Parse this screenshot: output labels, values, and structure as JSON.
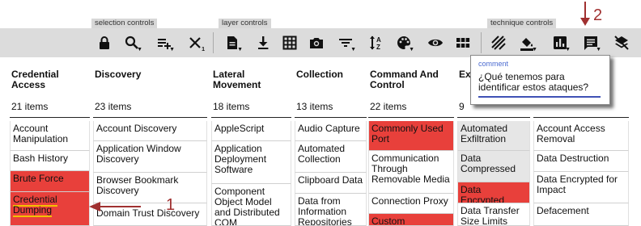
{
  "toolbar": {
    "groups": [
      "selection controls",
      "layer controls",
      "technique controls"
    ],
    "selection_multiselect_sub": "1"
  },
  "columns": [
    {
      "name": "Credential Access",
      "count": "21 items",
      "cells": [
        "Account Manipulation",
        "Bash History",
        "Brute Force",
        "Credential Dumping"
      ]
    },
    {
      "name": "Discovery",
      "count": "23 items",
      "cells": [
        "Account Discovery",
        "Application Window Discovery",
        "Browser Bookmark Discovery",
        "Domain Trust Discovery"
      ]
    },
    {
      "name": "Lateral Movement",
      "count": "18 items",
      "cells": [
        "AppleScript",
        "Application Deployment Software",
        "Component Object Model and Distributed COM"
      ]
    },
    {
      "name": "Collection",
      "count": "13 items",
      "cells": [
        "Audio Capture",
        "Automated Collection",
        "Clipboard Data",
        "Data from Information Repositories"
      ]
    },
    {
      "name": "Command And Control",
      "count": "22 items",
      "cells": [
        "Commonly Used Port",
        "Communication Through Removable Media",
        "Connection Proxy",
        "Custom Command"
      ]
    },
    {
      "name": "Ex",
      "count": "9",
      "cells": [
        "Automated Exfiltration",
        "Data Compressed",
        "Data Encrypted",
        "Data Transfer Size Limits"
      ]
    },
    {
      "name": "",
      "count": "",
      "cells": [
        "Account Access Removal",
        "Data Destruction",
        "Data Encrypted for Impact",
        "Defacement"
      ]
    }
  ],
  "comment": {
    "label": "comment",
    "text": "¿Qué tenemos para identificar estos ataques?"
  },
  "annotations": {
    "one": "1",
    "two": "2"
  },
  "colors": {
    "selected": "#e8403b",
    "highlight_underline": "#f4c000",
    "comment_accent": "#3f51b5",
    "annotation": "#a03030"
  }
}
